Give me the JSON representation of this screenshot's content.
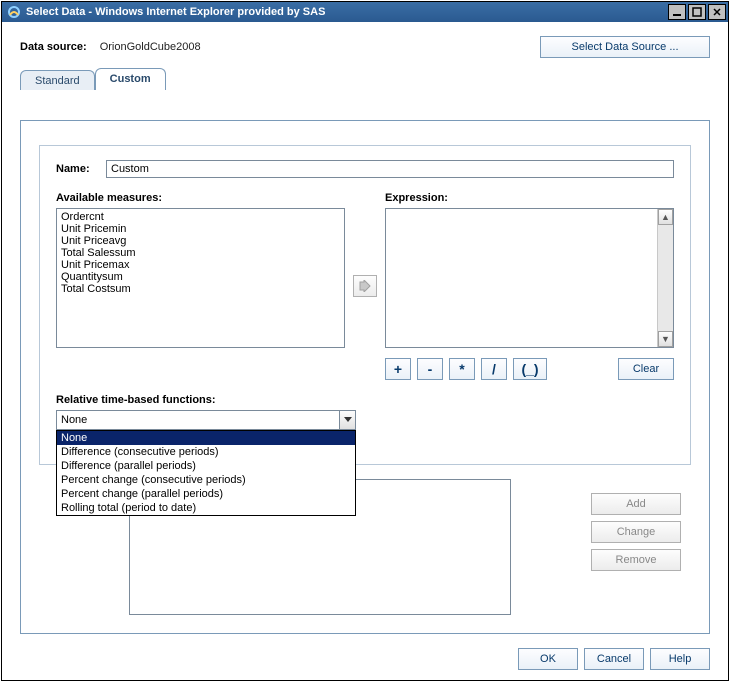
{
  "window": {
    "title": "Select Data - Windows Internet Explorer provided by SAS"
  },
  "topbar": {
    "data_source_label": "Data source:",
    "data_source_value": "OrionGoldCube2008",
    "select_ds_btn": "Select Data Source ..."
  },
  "tabs": {
    "standard": "Standard",
    "custom": "Custom"
  },
  "name_label": "Name:",
  "name_value": "Custom",
  "available_measures_label": "Available measures:",
  "available_measures": [
    "Ordercnt",
    "Unit Pricemin",
    "Unit Priceavg",
    "Total Salessum",
    "Unit Pricemax",
    "Quantitysum",
    "Total Costsum"
  ],
  "expression_label": "Expression:",
  "operators": {
    "plus": "+",
    "minus": "-",
    "mul": "*",
    "div": "/",
    "paren": "(_)"
  },
  "clear_btn": "Clear",
  "rtf_label": "Relative time-based functions:",
  "rtf_selected": "None",
  "rtf_options": [
    "None",
    "Difference (consecutive periods)",
    "Difference (parallel periods)",
    "Percent change (consecutive periods)",
    "Percent change (parallel periods)",
    "Rolling total (period to date)"
  ],
  "result_buttons": {
    "add": "Add",
    "change": "Change",
    "remove": "Remove"
  },
  "footer": {
    "ok": "OK",
    "cancel": "Cancel",
    "help": "Help"
  }
}
